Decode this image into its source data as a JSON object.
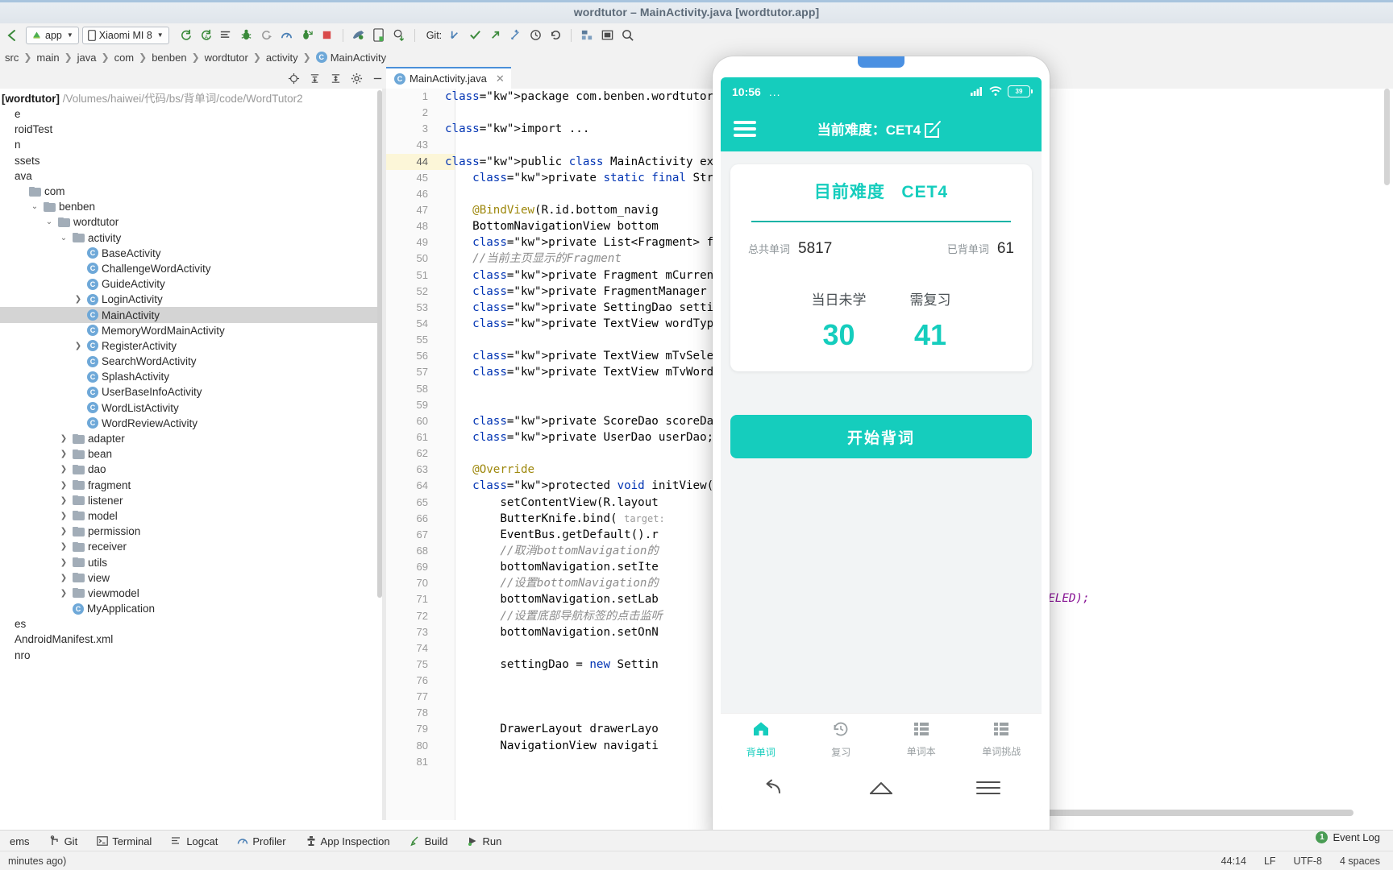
{
  "window": {
    "title": "wordtutor – MainActivity.java [wordtutor.app]"
  },
  "toolbar": {
    "run_config": "app",
    "device": "Xiaomi MI 8",
    "git_label": "Git:",
    "icons": [
      "back-arrow-icon",
      "sync-icon",
      "sync-alt-icon",
      "list-icon",
      "debug-bug-icon",
      "debug-step-icon",
      "profile-icon",
      "debug-attach-icon",
      "stop-icon",
      "avd-manager-icon",
      "device-manager-icon",
      "sdk-manager-icon",
      "git-update-icon",
      "git-commit-icon",
      "git-push-icon",
      "git-branch-icon",
      "git-history-icon",
      "git-rollback-icon",
      "structure-icon",
      "layout-icon",
      "search-icon"
    ]
  },
  "breadcrumb": {
    "items": [
      "src",
      "main",
      "java",
      "com",
      "benben",
      "wordtutor",
      "activity",
      "MainActivity"
    ]
  },
  "project": {
    "header_icons": [
      "target-icon",
      "collapse-all-icon",
      "expand-all-icon",
      "settings-gear-icon",
      "minimize-icon"
    ],
    "root_name": "[wordtutor]",
    "root_path": "/Volumes/haiwei/代码/bs/背单词/code/WordTutor2",
    "rows": [
      {
        "label": "e",
        "depth": 0,
        "type": "text"
      },
      {
        "label": "roidTest",
        "depth": 0,
        "type": "text"
      },
      {
        "label": "n",
        "depth": 0,
        "type": "text"
      },
      {
        "label": "ssets",
        "depth": 0,
        "type": "text"
      },
      {
        "label": "ava",
        "depth": 0,
        "type": "text"
      },
      {
        "label": "com",
        "depth": 1,
        "type": "folder"
      },
      {
        "label": "benben",
        "depth": 2,
        "type": "folder",
        "arrow": "v"
      },
      {
        "label": "wordtutor",
        "depth": 3,
        "type": "folder",
        "arrow": "v"
      },
      {
        "label": "activity",
        "depth": 4,
        "type": "folder",
        "arrow": "v"
      },
      {
        "label": "BaseActivity",
        "depth": 5,
        "type": "class"
      },
      {
        "label": "ChallengeWordActivity",
        "depth": 5,
        "type": "class"
      },
      {
        "label": "GuideActivity",
        "depth": 5,
        "type": "class"
      },
      {
        "label": "LoginActivity",
        "depth": 5,
        "type": "class",
        "arrow": ">"
      },
      {
        "label": "MainActivity",
        "depth": 5,
        "type": "class",
        "selected": true
      },
      {
        "label": "MemoryWordMainActivity",
        "depth": 5,
        "type": "class"
      },
      {
        "label": "RegisterActivity",
        "depth": 5,
        "type": "class",
        "arrow": ">"
      },
      {
        "label": "SearchWordActivity",
        "depth": 5,
        "type": "class"
      },
      {
        "label": "SplashActivity",
        "depth": 5,
        "type": "class"
      },
      {
        "label": "UserBaseInfoActivity",
        "depth": 5,
        "type": "class"
      },
      {
        "label": "WordListActivity",
        "depth": 5,
        "type": "class"
      },
      {
        "label": "WordReviewActivity",
        "depth": 5,
        "type": "class"
      },
      {
        "label": "adapter",
        "depth": 4,
        "type": "folder",
        "arrow": ">"
      },
      {
        "label": "bean",
        "depth": 4,
        "type": "folder",
        "arrow": ">"
      },
      {
        "label": "dao",
        "depth": 4,
        "type": "folder",
        "arrow": ">"
      },
      {
        "label": "fragment",
        "depth": 4,
        "type": "folder",
        "arrow": ">"
      },
      {
        "label": "listener",
        "depth": 4,
        "type": "folder",
        "arrow": ">"
      },
      {
        "label": "model",
        "depth": 4,
        "type": "folder",
        "arrow": ">"
      },
      {
        "label": "permission",
        "depth": 4,
        "type": "folder",
        "arrow": ">"
      },
      {
        "label": "receiver",
        "depth": 4,
        "type": "folder",
        "arrow": ">"
      },
      {
        "label": "utils",
        "depth": 4,
        "type": "folder",
        "arrow": ">"
      },
      {
        "label": "view",
        "depth": 4,
        "type": "folder",
        "arrow": ">"
      },
      {
        "label": "viewmodel",
        "depth": 4,
        "type": "folder",
        "arrow": ">"
      },
      {
        "label": "MyApplication",
        "depth": 4,
        "type": "class"
      },
      {
        "label": "es",
        "depth": 0,
        "type": "text"
      },
      {
        "label": "AndroidManifest.xml",
        "depth": 0,
        "type": "text"
      },
      {
        "label": "nro",
        "depth": 0,
        "type": "text"
      }
    ]
  },
  "editor": {
    "tab_label": "MainActivity.java",
    "caret_position": "44:14",
    "line_ending": "LF",
    "encoding": "UTF-8",
    "indent": "4 spaces",
    "lines": [
      {
        "num": "1",
        "text": "package com.benben.wordtutor.ac"
      },
      {
        "num": "2",
        "text": ""
      },
      {
        "num": "3",
        "text": "import ..."
      },
      {
        "num": "43",
        "text": ""
      },
      {
        "num": "44",
        "text": "public class MainActivity exten",
        "current": true
      },
      {
        "num": "45",
        "text": "    private static final String"
      },
      {
        "num": "46",
        "text": ""
      },
      {
        "num": "47",
        "text": "    @BindView(R.id.bottom_navig"
      },
      {
        "num": "48",
        "text": "    BottomNavigationView bottom"
      },
      {
        "num": "49",
        "text": "    private List<Fragment> frag"
      },
      {
        "num": "50",
        "text": "    //当前主页显示的Fragment"
      },
      {
        "num": "51",
        "text": "    private Fragment mCurrentFr"
      },
      {
        "num": "52",
        "text": "    private FragmentManager fra"
      },
      {
        "num": "53",
        "text": "    private SettingDao settingD"
      },
      {
        "num": "54",
        "text": "    private TextView wordType;"
      },
      {
        "num": "55",
        "text": ""
      },
      {
        "num": "56",
        "text": "    private TextView mTvSelect;"
      },
      {
        "num": "57",
        "text": "    private TextView mTvWordTyp"
      },
      {
        "num": "58",
        "text": ""
      },
      {
        "num": "59",
        "text": ""
      },
      {
        "num": "60",
        "text": "    private ScoreDao scoreDao;"
      },
      {
        "num": "61",
        "text": "    private UserDao userDao;"
      },
      {
        "num": "62",
        "text": ""
      },
      {
        "num": "63",
        "text": "    @Override"
      },
      {
        "num": "64",
        "text": "    protected void initView() {"
      },
      {
        "num": "65",
        "text": "        setContentView(R.layout"
      },
      {
        "num": "66",
        "text": "        ButterKnife.bind( target:"
      },
      {
        "num": "67",
        "text": "        EventBus.getDefault().r"
      },
      {
        "num": "68",
        "text": "        //取消bottomNavigation的"
      },
      {
        "num": "69",
        "text": "        bottomNavigation.setIte"
      },
      {
        "num": "70",
        "text": "        //设置bottomNavigation的"
      },
      {
        "num": "71",
        "text": "        bottomNavigation.setLab"
      },
      {
        "num": "72",
        "text": "        //设置底部导航标签的点击监听"
      },
      {
        "num": "73",
        "text": "        bottomNavigation.setOnN"
      },
      {
        "num": "74",
        "text": ""
      },
      {
        "num": "75",
        "text": "        settingDao = new Settin"
      },
      {
        "num": "76",
        "text": ""
      },
      {
        "num": "77",
        "text": ""
      },
      {
        "num": "78",
        "text": ""
      },
      {
        "num": "79",
        "text": "        DrawerLayout drawerLayo"
      },
      {
        "num": "80",
        "text": "        NavigationView navigati"
      },
      {
        "num": "81",
        "text": ""
      }
    ],
    "right_fragment": "TY_LABELED);"
  },
  "bottom_tools": {
    "items": [
      "ems",
      "Git",
      "Terminal",
      "Logcat",
      "Profiler",
      "App Inspection",
      "Build",
      "Run"
    ],
    "status_text": "minutes ago)",
    "event_log": "Event Log",
    "event_log_count": "1"
  },
  "phone": {
    "status": {
      "time": "10:56",
      "dots": "...",
      "signal": "signal-icon",
      "wifi": "wifi-icon",
      "battery": "39"
    },
    "appbar": {
      "menu": "hamburger-icon",
      "title": "当前难度：CET4",
      "edit_icon": "edit-square-icon"
    },
    "card": {
      "title_prefix": "目前难度",
      "title_value": "CET4",
      "total_label": "总共单词",
      "total_value": "5817",
      "learned_label": "已背单词",
      "learned_value": "61",
      "stats": [
        {
          "label": "当日未学",
          "value": "30"
        },
        {
          "label": "需复习",
          "value": "41"
        }
      ]
    },
    "start_button": "开始背词",
    "bottom_nav": [
      {
        "label": "背单词",
        "icon": "home-icon",
        "active": true
      },
      {
        "label": "复习",
        "icon": "history-clock-icon",
        "active": false
      },
      {
        "label": "单词本",
        "icon": "list-view-icon",
        "active": false
      },
      {
        "label": "单词挑战",
        "icon": "list-view-icon",
        "active": false
      }
    ],
    "sys_nav": [
      {
        "icon": "back-arrow-icon"
      },
      {
        "icon": "home-outline-icon"
      },
      {
        "icon": "recents-hamburger-icon"
      }
    ]
  },
  "colors": {
    "teal": "#15cdbd",
    "teal_dark": "#19b3a6",
    "ide_chrome": "#f2f2f2",
    "selection": "#d4d4d4"
  }
}
